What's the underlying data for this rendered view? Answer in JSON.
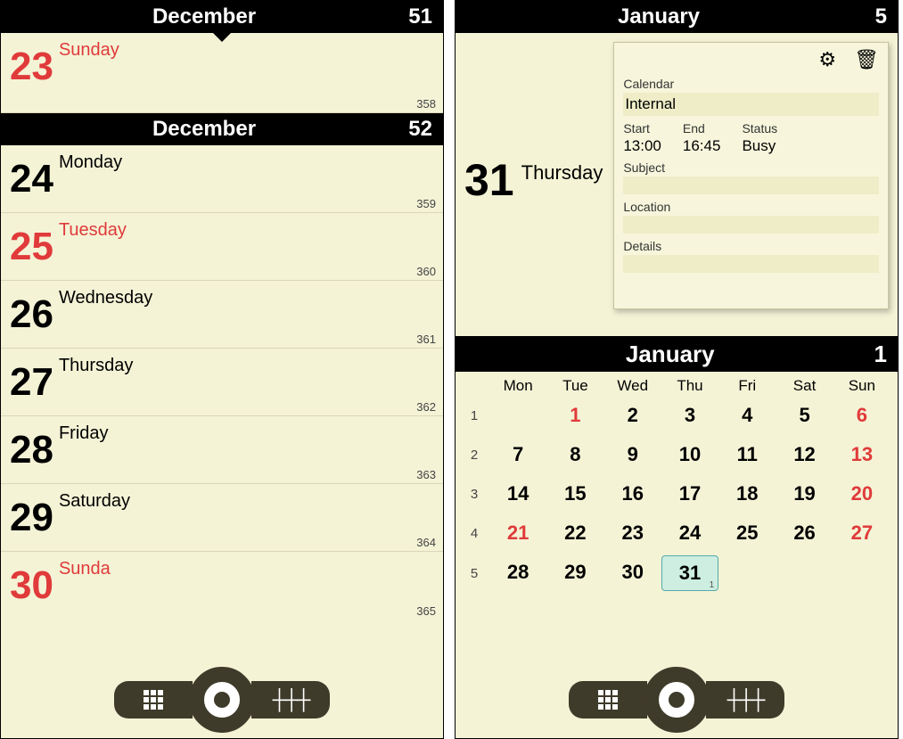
{
  "left": {
    "headers": [
      {
        "month": "December",
        "week": "51"
      },
      {
        "month": "December",
        "week": "52"
      }
    ],
    "days": [
      {
        "num": "23",
        "dow": "Sunday",
        "doy": "358",
        "red": true
      },
      {
        "num": "24",
        "dow": "Monday",
        "doy": "359",
        "red": false
      },
      {
        "num": "25",
        "dow": "Tuesday",
        "doy": "360",
        "red": true
      },
      {
        "num": "26",
        "dow": "Wednesday",
        "doy": "361",
        "red": false
      },
      {
        "num": "27",
        "dow": "Thursday",
        "doy": "362",
        "red": false
      },
      {
        "num": "28",
        "dow": "Friday",
        "doy": "363",
        "red": false
      },
      {
        "num": "29",
        "dow": "Saturday",
        "doy": "364",
        "red": false
      },
      {
        "num": "30",
        "dow": "Sunda",
        "doy": "365",
        "red": true
      }
    ]
  },
  "right_top": {
    "header": {
      "month": "January",
      "week": "5"
    },
    "day": {
      "num": "31",
      "dow": "Thursday"
    },
    "card": {
      "labels": {
        "calendar": "Calendar",
        "start": "Start",
        "end": "End",
        "status": "Status",
        "subject": "Subject",
        "location": "Location",
        "details": "Details"
      },
      "values": {
        "calendar": "Internal",
        "start": "13:00",
        "end": "16:45",
        "status": "Busy",
        "subject": "",
        "location": "",
        "details": ""
      }
    }
  },
  "right_month": {
    "header": {
      "month": "January",
      "week": "1"
    },
    "dow": [
      "Mon",
      "Tue",
      "Wed",
      "Thu",
      "Fri",
      "Sat",
      "Sun"
    ],
    "weeks": [
      {
        "wk": "1",
        "cells": [
          {
            "t": "",
            "e": true
          },
          {
            "t": "1",
            "flag": true
          },
          {
            "t": "2"
          },
          {
            "t": "3"
          },
          {
            "t": "4"
          },
          {
            "t": "5"
          },
          {
            "t": "6",
            "red": true
          }
        ]
      },
      {
        "wk": "2",
        "cells": [
          {
            "t": "7"
          },
          {
            "t": "8"
          },
          {
            "t": "9"
          },
          {
            "t": "10"
          },
          {
            "t": "11"
          },
          {
            "t": "12"
          },
          {
            "t": "13",
            "red": true
          }
        ]
      },
      {
        "wk": "3",
        "cells": [
          {
            "t": "14"
          },
          {
            "t": "15"
          },
          {
            "t": "16"
          },
          {
            "t": "17"
          },
          {
            "t": "18"
          },
          {
            "t": "19"
          },
          {
            "t": "20",
            "flag": true
          }
        ]
      },
      {
        "wk": "4",
        "cells": [
          {
            "t": "21",
            "flag": true
          },
          {
            "t": "22"
          },
          {
            "t": "23"
          },
          {
            "t": "24"
          },
          {
            "t": "25"
          },
          {
            "t": "26"
          },
          {
            "t": "27",
            "red": true
          }
        ]
      },
      {
        "wk": "5",
        "cells": [
          {
            "t": "28"
          },
          {
            "t": "29"
          },
          {
            "t": "30"
          },
          {
            "t": "31",
            "sel": true,
            "sub": "1"
          },
          {
            "t": "",
            "e": true
          },
          {
            "t": "",
            "e": true
          },
          {
            "t": "",
            "e": true
          }
        ]
      }
    ]
  },
  "toolbar": {
    "grid_label": "grid-view",
    "record_label": "record",
    "sliders_label": "settings"
  }
}
